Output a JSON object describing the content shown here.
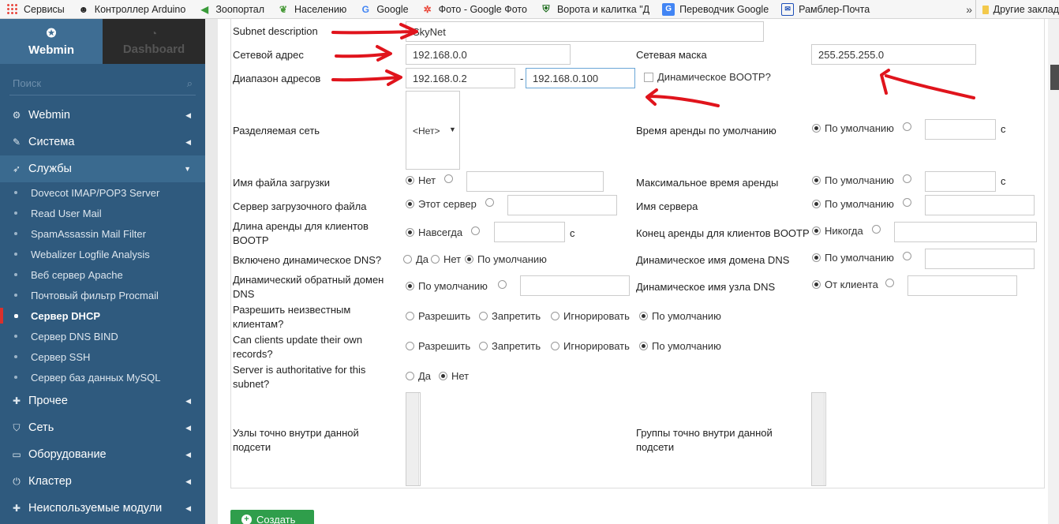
{
  "bookmarks": {
    "apps": "Сервисы",
    "items": [
      "Контроллер Arduino",
      "Зоопортал",
      "Населению",
      "Google",
      "Фото - Google Фото",
      "Ворота и калитка \"Д",
      "Переводчик Google",
      "Рамблер-Почта"
    ],
    "more": "»",
    "other": "Другие заклад"
  },
  "sidebar": {
    "tab_webmin": "Webmin",
    "tab_dashboard": "Dashboard",
    "search_placeholder": "Поиск",
    "menu": {
      "webmin": "Webmin",
      "system": "Система",
      "services": "Службы",
      "other": "Прочее",
      "network": "Сеть",
      "hardware": "Оборудование",
      "cluster": "Кластер",
      "unused": "Неиспользуемые модули"
    },
    "services_items": [
      "Dovecot IMAP/POP3 Server",
      "Read User Mail",
      "SpamAssassin Mail Filter",
      "Webalizer Logfile Analysis",
      "Веб сервер Apache",
      "Почтовый фильтр Procmail",
      "Сервер DHCP",
      "Сервер DNS BIND",
      "Сервер SSH",
      "Сервер баз данных MySQL"
    ]
  },
  "form": {
    "subnet_description": {
      "label": "Subnet description",
      "value": "SkyNet"
    },
    "network_address": {
      "label": "Сетевой адрес",
      "value": "192.168.0.0"
    },
    "netmask": {
      "label": "Сетевая маска",
      "value": "255.255.255.0"
    },
    "address_range": {
      "label": "Диапазон адресов",
      "from": "192.168.0.2",
      "sep": "-",
      "to": "192.168.0.100",
      "bootp": "Динамическое BOOTP?"
    },
    "shared_network": {
      "label": "Разделяемая сеть",
      "value": "<Нет>"
    },
    "default_lease": {
      "label": "Время аренды по умолчанию",
      "opt_default": "По умолчанию",
      "unit": "с"
    },
    "boot_file": {
      "label": "Имя файла загрузки",
      "opt_none": "Нет"
    },
    "max_lease": {
      "label": "Максимальное время аренды",
      "opt_default": "По умолчанию",
      "unit": "с"
    },
    "boot_server": {
      "label": "Сервер загрузочного файла",
      "opt_this": "Этот сервер"
    },
    "server_name": {
      "label": "Имя сервера",
      "opt_default": "По умолчанию"
    },
    "bootp_lease": {
      "label_1": "Длина аренды для клиентов",
      "label_2": "BOOTP",
      "opt_forever": "Навсегда",
      "unit": "с"
    },
    "bootp_end": {
      "label": "Конец аренды для клиентов BOOTP",
      "opt_never": "Никогда"
    },
    "ddns_enabled": {
      "label": "Включено динамическое DNS?",
      "opt_yes": "Да",
      "opt_no": "Нет",
      "opt_default": "По умолчанию"
    },
    "ddns_domain": {
      "label": "Динамическое имя домена DNS",
      "opt_default": "По умолчанию"
    },
    "ddns_rev": {
      "label_1": "Динамический обратный домен",
      "label_2": "DNS",
      "opt_default": "По умолчанию"
    },
    "ddns_host": {
      "label": "Динамическое имя узла DNS",
      "opt_client": "От клиента"
    },
    "unknown_clients": {
      "label_1": "Разрешить неизвестным",
      "label_2": "клиентам?",
      "allow": "Разрешить",
      "deny": "Запретить",
      "ignore": "Игнорировать",
      "default": "По умолчанию"
    },
    "client_updates": {
      "label_1": "Can clients update their own",
      "label_2": "records?",
      "allow": "Разрешить",
      "deny": "Запретить",
      "ignore": "Игнорировать",
      "default": "По умолчанию"
    },
    "authoritative": {
      "label_1": "Server is authoritative for this",
      "label_2": "subnet?",
      "yes": "Да",
      "no": "Нет"
    },
    "hosts": {
      "label_1": "Узлы точно внутри данной",
      "label_2": "подсети"
    },
    "groups": {
      "label_1": "Группы точно внутри данной",
      "label_2": "подсети"
    }
  },
  "create_button": "Создать",
  "colors": {
    "sidebar": "#2f5a7e",
    "accent_red": "#e0141c",
    "create": "#2f9e4b"
  }
}
